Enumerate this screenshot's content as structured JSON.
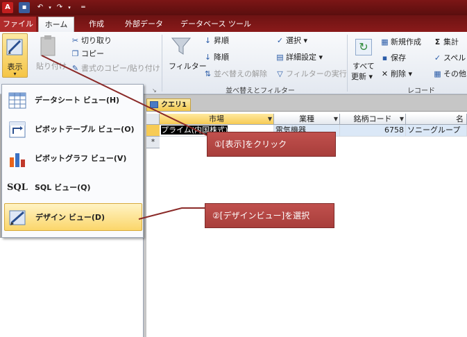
{
  "titlebar": {
    "app_icon_letter": "A",
    "save_icon": "save-icon",
    "undo_icon": "undo-icon",
    "redo_icon": "redo-icon"
  },
  "tabs": [
    {
      "label": "ファイル"
    },
    {
      "label": "ホーム"
    },
    {
      "label": "作成"
    },
    {
      "label": "外部データ"
    },
    {
      "label": "データベース ツール"
    }
  ],
  "ribbon": {
    "view_label": "表示",
    "paste_label": "貼り付け",
    "cut_label": "切り取り",
    "copy_label": "コピー",
    "format_painter_label": "書式のコピー/貼り付け",
    "filter_label": "フィルター",
    "ascending_label": "昇順",
    "descending_label": "降順",
    "remove_sort_label": "並べ替えの解除",
    "selection_label": "選択 ▾",
    "advanced_label": "詳細設定 ▾",
    "toggle_filter_label": "フィルターの実行",
    "sort_filter_group": "並べ替えとフィルター",
    "refresh_label_1": "すべて",
    "refresh_label_2": "更新 ▾",
    "new_label": "新規作成",
    "save_label": "保存",
    "delete_label": "削除 ▾",
    "totals_label": "集計",
    "spell_label": "スペル",
    "more_label": "その他",
    "records_group": "レコード"
  },
  "view_menu": [
    {
      "label": "データシート ビュー(H)"
    },
    {
      "label": "ピボットテーブル ビュー(O)"
    },
    {
      "label": "ピボットグラフ ビュー(V)"
    },
    {
      "label": "SQL ビュー(Q)",
      "icon_text": "SQL"
    },
    {
      "label": "デザイン ビュー(D)"
    }
  ],
  "query": {
    "tab_label": "クエリ1",
    "columns": [
      "市場",
      "業種",
      "銘柄コード",
      "名"
    ],
    "rows": [
      [
        "プライム(内国株式)",
        "電気機器",
        "6758",
        "ソニーグループ"
      ]
    ],
    "new_row_marker": "*"
  },
  "callouts": {
    "step1": "①[表示]をクリック",
    "step2": "②[デザインビュー]を選択"
  },
  "colors": {
    "accent": "#8a1a1a",
    "highlight": "#f7cb55",
    "callout": "#b5473f"
  }
}
